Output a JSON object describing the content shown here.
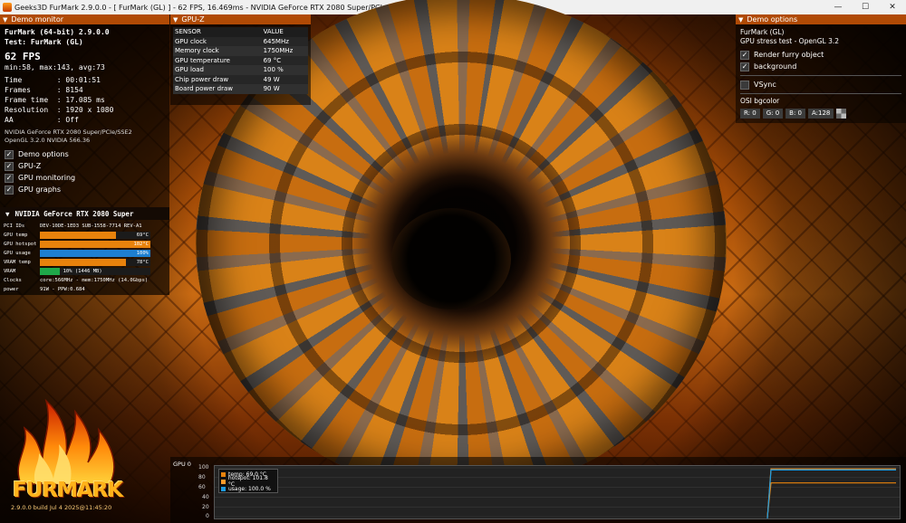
{
  "titlebar": {
    "title": "Geeks3D FurMark 2.9.0.0 - [ FurMark (GL) ] - 62 FPS, 16.469ms - NVIDIA GeForce RTX 2080 Super/PCIe/SSE2",
    "minimize": "—",
    "maximize": "☐",
    "close": "✕"
  },
  "demo_monitor": {
    "header": "Demo monitor",
    "app": "FurMark (64-bit) 2.9.0.0",
    "test": "Test: FurMark (GL)",
    "fps": "62 FPS",
    "fps_stats": "min:58, max:143, avg:73",
    "time": "Time        : 00:01:51",
    "frames": "Frames      : 8154",
    "frame_time": "Frame time  : 17.085 ms",
    "resolution": "Resolution  : 1920 x 1080",
    "aa": "AA          : Off",
    "renderer": "NVIDIA GeForce RTX 2080 Super/PCIe/SSE2",
    "gl": "OpenGL 3.2.0 NVIDIA 566.36",
    "checks": [
      "Demo options",
      "GPU-Z",
      "GPU monitoring",
      "GPU graphs"
    ]
  },
  "gpu_monitor": {
    "header": "NVIDIA GeForce RTX 2080 Super",
    "pci_label": "PCI IDs",
    "pci_value": "DEV-10DE-1ED3 SUB-1558-7714 REV-A1",
    "bars": [
      {
        "label": "GPU temp",
        "text": "69°C",
        "fraction": 0.69,
        "color": "#e8820c"
      },
      {
        "label": "GPU hotspot",
        "text": "102°C",
        "fraction": 1.0,
        "color": "#e8820c"
      },
      {
        "label": "GPU usage",
        "text": "100%",
        "fraction": 1.0,
        "color": "#1e7fd0"
      },
      {
        "label": "VRAM temp",
        "text": "78°C",
        "fraction": 0.78,
        "color": "#e8820c"
      },
      {
        "label": "VRAM",
        "text": "10% (1446 MB)",
        "fraction": 0.18,
        "color": "#1fa84a"
      }
    ],
    "clocks_label": "Clocks",
    "clocks_value": "core:566MHz - mem:1750MHz (14.0Gbps)",
    "power_label": "power",
    "power_value": "91W - PPW:0.684"
  },
  "gpuz": {
    "header": "GPU-Z",
    "col_sensor": "SENSOR",
    "col_value": "VALUE",
    "rows": [
      {
        "sensor": "GPU clock",
        "value": "645MHz"
      },
      {
        "sensor": "Memory clock",
        "value": "1750MHz"
      },
      {
        "sensor": "GPU temperature",
        "value": "69 °C"
      },
      {
        "sensor": "GPU load",
        "value": "100 %"
      },
      {
        "sensor": "Chip power draw",
        "value": "49 W"
      },
      {
        "sensor": "Board power draw",
        "value": "90 W"
      }
    ]
  },
  "demo_options": {
    "header": "Demo options",
    "name": "FurMark (GL)",
    "desc": "GPU stress test - OpenGL 3.2",
    "render_furry": "Render furry object",
    "background": "background",
    "vsync": "VSync",
    "osi_label": "OSI bgcolor",
    "r": "R: 0",
    "g": "G: 0",
    "b": "B: 0",
    "a": "A:128"
  },
  "logo": {
    "brand": "FURMARK",
    "build": "2.9.0.0 build Jul  4 2025@11:45:20"
  },
  "graph": {
    "label": "GPU 0",
    "legend": [
      "temp: 69.0 °C",
      "hotspot: 101.8 °C",
      "usage: 100.0 %"
    ],
    "legend_colors": [
      "#e8820c",
      "#ff9a2a",
      "#1e9be0"
    ],
    "yticks": [
      "100",
      "80",
      "60",
      "40",
      "20",
      "0"
    ]
  },
  "chart_data": {
    "type": "line",
    "ylim": [
      0,
      100
    ],
    "series": [
      {
        "name": "temp: 69.0 °C",
        "values": [
          0,
          69,
          69,
          69,
          69,
          69,
          69
        ]
      },
      {
        "name": "hotspot: 101.8 °C",
        "values": [
          0,
          100,
          100,
          100,
          100,
          100,
          100
        ]
      },
      {
        "name": "usage: 100.0 %",
        "values": [
          0,
          100,
          100,
          100,
          100,
          100,
          100
        ]
      }
    ]
  }
}
